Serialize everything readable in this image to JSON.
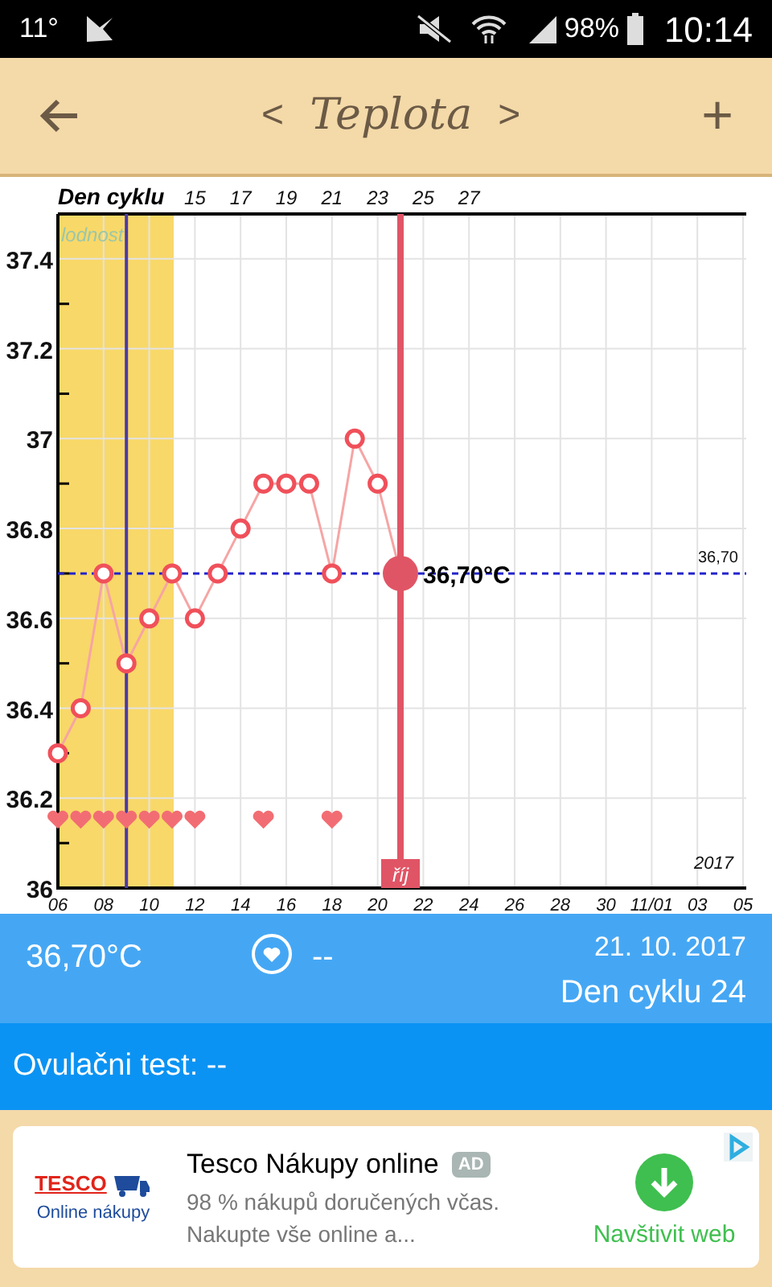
{
  "status_bar": {
    "temperature": "11°",
    "battery": "98%",
    "time": "10:14"
  },
  "header": {
    "title": "Teplota",
    "prev": "<",
    "next": ">",
    "add": "+"
  },
  "chart": {
    "year_label": "2017",
    "selected_label": "36,70°C",
    "chart_data": {
      "type": "line",
      "grid": true,
      "bands": [
        {
          "axis": "x2",
          "from": 9,
          "to": 14,
          "color": "#f8d868",
          "label": "lodnost"
        }
      ],
      "ref_lines": [
        {
          "axis": "x2",
          "value": 12,
          "color": "#4a3aa8"
        },
        {
          "axis": "y",
          "value": 36.7,
          "color": "#2222cc",
          "label": "36,70"
        },
        {
          "axis": "x2",
          "value": 24,
          "color": "#e05565",
          "label": "říj"
        }
      ],
      "categories": [
        "06",
        null,
        "08",
        null,
        "10",
        null,
        "12",
        null,
        "14",
        null,
        "16",
        null,
        "18",
        null,
        "20",
        null,
        "22",
        null,
        "24",
        null,
        "26",
        null,
        "28",
        null,
        "30",
        null,
        "11/01",
        null,
        "03",
        null,
        "05"
      ],
      "series": [
        {
          "color": "#f0505a",
          "marker": "circle",
          "values": [
            36.3,
            36.4,
            36.7,
            36.5,
            36.6,
            36.7,
            36.6,
            36.7,
            36.8,
            36.9,
            36.9,
            36.9,
            36.7,
            37.0,
            36.9,
            36.7,
            null,
            null,
            null,
            null,
            null,
            null,
            null,
            null,
            null,
            null,
            null,
            null,
            null,
            null,
            null
          ]
        },
        {
          "type": "scatter",
          "color": "#f26d73",
          "values": [
            36.15,
            36.15,
            36.15,
            36.15,
            36.15,
            36.15,
            36.15,
            null,
            null,
            36.15,
            null,
            null,
            36.15,
            null,
            null,
            null,
            null,
            null,
            null,
            null,
            null,
            null,
            null,
            null,
            null,
            null,
            null,
            null,
            null,
            null,
            null
          ]
        }
      ],
      "ylim": [
        36,
        37.5
      ],
      "yticks": [
        {
          "value": 36,
          "label": "36"
        },
        {
          "value": 36.2,
          "label": "36.2"
        },
        {
          "value": 36.4,
          "label": "36.4"
        },
        {
          "value": 36.6,
          "label": "36.6"
        },
        {
          "value": 36.8,
          "label": "36.8"
        },
        {
          "value": 37,
          "label": "37"
        },
        {
          "value": 37.2,
          "label": "37.2"
        },
        {
          "value": 37.4,
          "label": "37.4"
        }
      ],
      "x2label": "Den cyklu",
      "x2lim": [
        9,
        39
      ],
      "x2ticks": [
        15,
        17,
        19,
        21,
        23,
        25,
        27
      ]
    }
  },
  "summary": {
    "temperature": "36,70°C",
    "intercourse": "--",
    "date": "21. 10. 2017",
    "cycle_day": "Den cyklu 24"
  },
  "ovulation_test": {
    "label": "Ovulačni test: --"
  },
  "ad": {
    "logo_brand": "TESCO",
    "logo_caption": "Online nákupy",
    "title": "Tesco Nákupy online",
    "badge": "AD",
    "description": "98 % nákupů doručených včas. Nakupte vše online a...",
    "action": "Navštivit web"
  }
}
